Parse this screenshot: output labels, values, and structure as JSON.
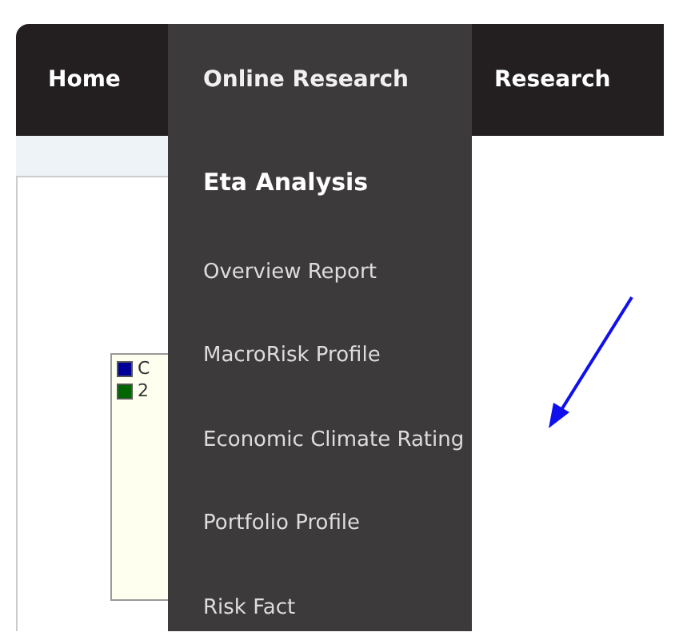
{
  "nav_tabs": [
    {
      "label": "Home",
      "selected": false
    },
    {
      "label": "Online Research",
      "selected": true
    },
    {
      "label": "Research",
      "selected": false
    }
  ],
  "dropdown": {
    "heading": "Eta Analysis",
    "items": [
      "Overview Report",
      "MacroRisk Profile",
      "Economic Climate Rating",
      "Portfolio Profile",
      "Risk Fact"
    ]
  },
  "legend": [
    {
      "label": "C",
      "color": "#000099"
    },
    {
      "label": "2",
      "color": "#006600"
    }
  ]
}
